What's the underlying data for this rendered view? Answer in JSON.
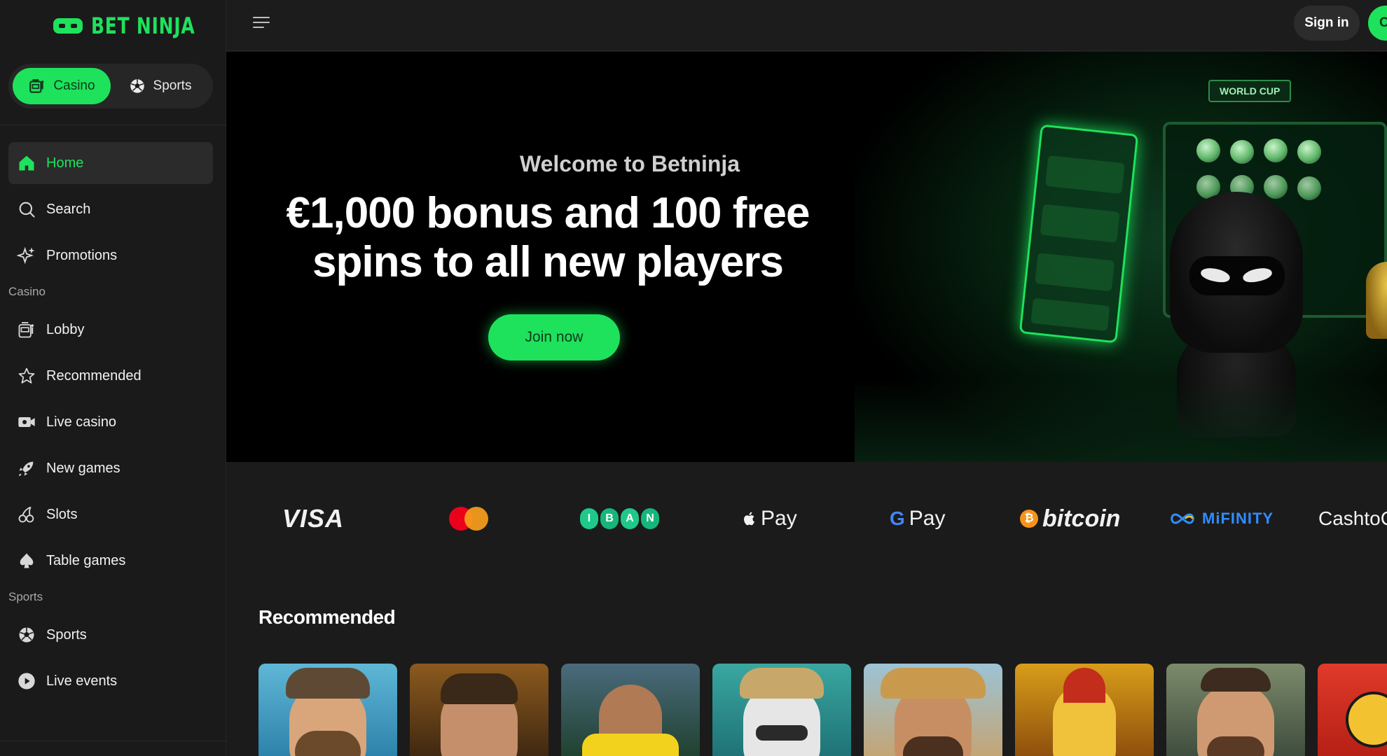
{
  "brand": {
    "logo_text": "BET NINJA"
  },
  "mode_switch": {
    "casino_label": "Casino",
    "sports_label": "Sports",
    "active": "casino"
  },
  "nav": {
    "main": [
      {
        "label": "Home",
        "icon": "home-icon",
        "active": true
      },
      {
        "label": "Search",
        "icon": "search-icon"
      },
      {
        "label": "Promotions",
        "icon": "sparkles-icon"
      }
    ],
    "casino_section_label": "Casino",
    "casino": [
      {
        "label": "Lobby",
        "icon": "slot-machine-icon"
      },
      {
        "label": "Recommended",
        "icon": "star-icon"
      },
      {
        "label": "Live casino",
        "icon": "video-camera-icon"
      },
      {
        "label": "New games",
        "icon": "rocket-icon"
      },
      {
        "label": "Slots",
        "icon": "cherries-icon"
      },
      {
        "label": "Table games",
        "icon": "spade-icon"
      }
    ],
    "sports_section_label": "Sports",
    "sports": [
      {
        "label": "Sports",
        "icon": "soccer-ball-icon"
      },
      {
        "label": "Live events",
        "icon": "play-circle-icon"
      }
    ]
  },
  "topbar": {
    "signin_label": "Sign in",
    "register_label": "C"
  },
  "hero": {
    "subtitle": "Welcome to Betninja",
    "title_line1": "€1,000 bonus and 100 free",
    "title_line2": "spins to all new players",
    "cta_label": "Join now",
    "sign_text": "WORLD CUP"
  },
  "payments": {
    "visa": "VISA",
    "iban": [
      "I",
      "B",
      "A",
      "N"
    ],
    "apple_pay": "Pay",
    "google_pay": "Pay",
    "bitcoin": "bitcoin",
    "mifinity": "MiFINITY",
    "cashto": "CashtoC"
  },
  "recommended": {
    "title": "Recommended"
  },
  "colors": {
    "accent": "#1ee25c",
    "sidebar_bg": "#1a1a1a",
    "page_bg": "#1b1b1b",
    "hero_bg": "#000000"
  }
}
